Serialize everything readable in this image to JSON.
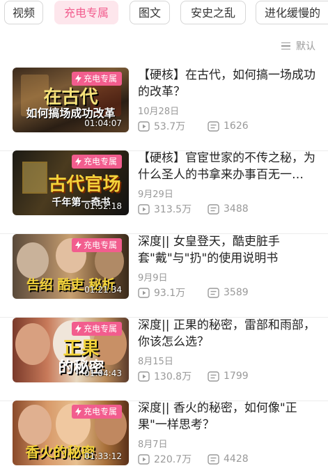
{
  "tabs": [
    {
      "label": "视频",
      "active": false
    },
    {
      "label": "充电专属",
      "active": true
    },
    {
      "label": "图文",
      "active": false
    },
    {
      "label": "安史之乱",
      "active": false
    },
    {
      "label": "进化缓慢的",
      "active": false
    }
  ],
  "sort": {
    "label": "默认",
    "icon": "list-sort-icon"
  },
  "colors": {
    "accent": "#f25d8e",
    "accent_bg": "#fde6ec",
    "muted": "#999999"
  },
  "videos": [
    {
      "badge": "充电专属",
      "thumb_text": [
        "在古代",
        "如何搞场成功改革"
      ],
      "duration": "01:04:07",
      "title": "【硬核】在古代，如何搞一场成功的改革？",
      "date": "10月28日",
      "views": "53.7万",
      "comments": "1626"
    },
    {
      "badge": "充电专属",
      "thumb_text": [
        "古代官场",
        "千年第一奇书"
      ],
      "duration": "01:52:18",
      "title": "【硬核】官宦世家的不传之秘，为什么圣人的书拿来办事百无一…",
      "date": "9月29日",
      "views": "313.5万",
      "comments": "3488"
    },
    {
      "badge": "充电专属",
      "thumb_text": [
        "告绍 酷吏 秘析"
      ],
      "duration": "01:21:34",
      "title": "深度|| 女皇登天，酷吏脏手套\"戴\"与\"扔\"的使用说明书",
      "date": "9月9日",
      "views": "93.1万",
      "comments": "3589"
    },
    {
      "badge": "充电专属",
      "thumb_text": [
        "正果",
        "的秘密"
      ],
      "duration": "01:04:43",
      "title": "深度|| 正果的秘密，雷部和雨部，你该怎么选？",
      "date": "8月15日",
      "views": "130.8万",
      "comments": "1799"
    },
    {
      "badge": "充电专属",
      "thumb_text": [
        "香火的秘密"
      ],
      "duration": "01:33:12",
      "title": "深度|| 香火的秘密，如何像\"正果\"一样思考？",
      "date": "8月7日",
      "views": "220.7万",
      "comments": "4428"
    }
  ]
}
